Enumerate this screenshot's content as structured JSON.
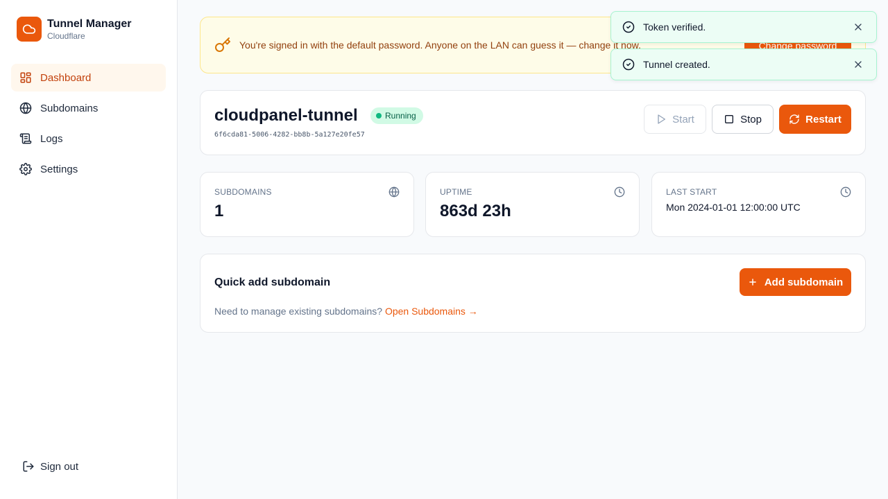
{
  "brand": {
    "title": "Tunnel Manager",
    "subtitle": "Cloudflare"
  },
  "sidebar": {
    "items": [
      {
        "label": "Dashboard",
        "icon": "dashboard-icon",
        "active": true
      },
      {
        "label": "Subdomains",
        "icon": "globe-icon"
      },
      {
        "label": "Logs",
        "icon": "scroll-icon"
      },
      {
        "label": "Settings",
        "icon": "gear-icon"
      }
    ],
    "signout_label": "Sign out"
  },
  "banner": {
    "text": "You're signed in with the default password. Anyone on the LAN can guess it — change it now.",
    "button_label": "Change password"
  },
  "toasts": [
    {
      "text": "Token verified."
    },
    {
      "text": "Tunnel created."
    }
  ],
  "tunnel": {
    "name": "cloudpanel-tunnel",
    "status": "Running",
    "id": "6f6cda81-5006-4282-bb8b-5a127e20fe57",
    "start_label": "Start",
    "stop_label": "Stop",
    "restart_label": "Restart"
  },
  "stats": {
    "subdomains": {
      "label": "SUBDOMAINS",
      "value": "1"
    },
    "uptime": {
      "label": "UPTIME",
      "value": "863d 23h"
    },
    "last_start": {
      "label": "LAST START",
      "value": "Mon 2024-01-01 12:00:00 UTC"
    }
  },
  "quick_add": {
    "title": "Quick add subdomain",
    "add_label": "Add subdomain",
    "desc": "Need to manage existing subdomains?",
    "link": "Open Subdomains →"
  },
  "colors": {
    "accent": "#ea580c",
    "success": "#10b981",
    "warning_bg": "#fefce8"
  }
}
